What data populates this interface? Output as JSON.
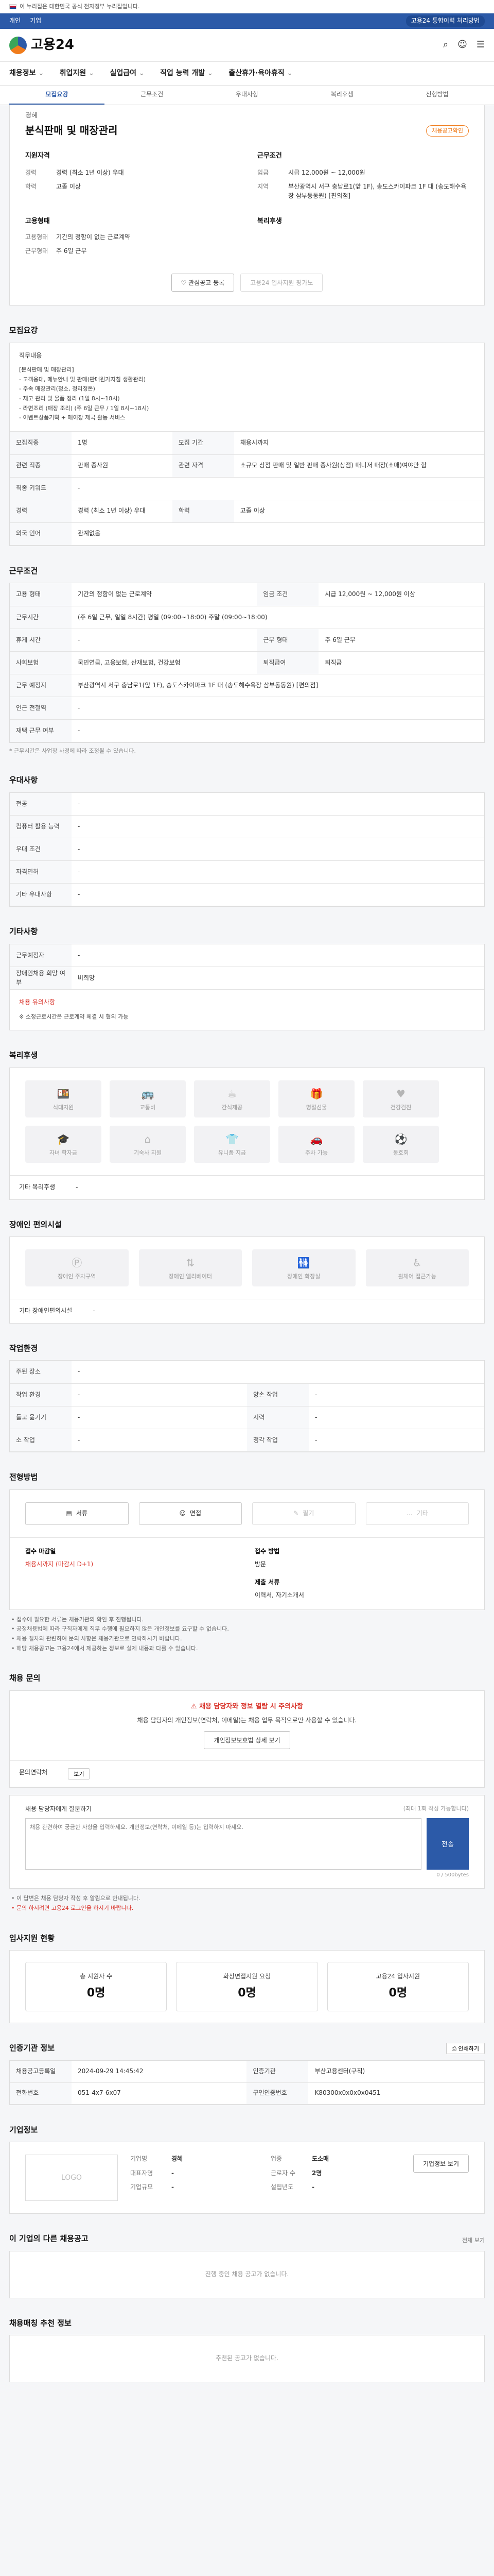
{
  "gov_bar": {
    "text": "이 누리집은 대한민국 공식 전자정부 누리집입니다."
  },
  "util": {
    "left": [
      "개인",
      "기업"
    ],
    "right_pill": "고용24 통합이력 처리방법"
  },
  "logo": {
    "text": "고용24"
  },
  "gnb": [
    "채용정보",
    "취업지원",
    "실업급여",
    "직업 능력 개발",
    "출산휴가·육아휴직"
  ],
  "subtabs": [
    "모집요강",
    "근무조건",
    "우대사항",
    "복리후생",
    "전형방법"
  ],
  "summary": {
    "brand": "경혜",
    "title": "분식판매 및 매장관리",
    "badge": "채용공고확인",
    "qual_title": "지원자격",
    "qual": [
      {
        "k": "경력",
        "v": "경력 (최소 1년 이상) 우대"
      },
      {
        "k": "학력",
        "v": "고졸 이상"
      }
    ],
    "cond_title": "근무조건",
    "cond": [
      {
        "k": "임금",
        "v": "시급 12,000원 ~ 12,000원"
      },
      {
        "k": "지역",
        "v": "부산광역시 서구 충남로1(앞 1F), 송도스카이파크 1F 대 (송도해수욕장 삼부동동원) [편의점]"
      }
    ],
    "form_title": "고용형태",
    "form": [
      {
        "k": "고용형태",
        "v": "기간의 정함이 없는 근로계약"
      },
      {
        "k": "근무형태",
        "v": "주 6일 근무"
      }
    ],
    "benefit_title": "복리후생",
    "btn_scrap": "관심공고 등록",
    "btn_sim": "고용24 입사지원 평가노"
  },
  "recruit": {
    "title": "모집요강",
    "desc_label": "직무내용",
    "desc": "[분식판매 및 매장관리]\n- 고객응대, 메뉴안내 및 판매(판매원가지침 생활관리)\n- 주속 매장관리(청소, 정리정돈)\n- 재고 관리 및 물품 정리 (1일 8시~18시)\n- 라면조리 (매장 조리) (주 6일 근무 / 1일 8시~18시)\n- 이벤트상품기획 + 매이창 제국 활동 서비스",
    "rows": [
      [
        {
          "k": "모집직종",
          "v": "1명"
        },
        {
          "k": "모집 기간",
          "v": "채용시까지"
        }
      ],
      [
        {
          "k": "관련 직종",
          "v": "판매 종사원"
        },
        {
          "k": "관련 자격",
          "v": "소규모 상점 판매 및 일반 판매 종사원(상점) 매니저 매장(소매)여야만 함"
        }
      ],
      [
        {
          "k": "직종 키워드",
          "v": "-"
        },
        {
          "k": "",
          "v": ""
        }
      ],
      [
        {
          "k": "경력",
          "v": "경력 (최소 1년 이상) 우대"
        },
        {
          "k": "학력",
          "v": "고졸 이상"
        }
      ],
      [
        {
          "k": "외국 언어",
          "v": "관계없음"
        },
        {
          "k": "",
          "v": ""
        }
      ]
    ]
  },
  "work": {
    "title": "근무조건",
    "rows": [
      [
        {
          "k": "고용 형태",
          "v": "기간의 정함이 없는 근로계약"
        },
        {
          "k": "임금 조건",
          "v": "시급 12,000원 ~ 12,000원 이상"
        }
      ],
      [
        {
          "k": "근무시간",
          "v": "(주 6일 근무, 일일 8시간) 평일 (09:00~18:00) 주말 (09:00~18:00)"
        },
        {
          "k": "",
          "v": ""
        }
      ],
      [
        {
          "k": "휴게 시간",
          "v": "-"
        },
        {
          "k": "근무 형태",
          "v": "주 6일 근무"
        }
      ],
      [
        {
          "k": "사회보험",
          "v": "국민연금, 고용보험, 산재보험, 건강보험"
        },
        {
          "k": "퇴직급여",
          "v": "퇴직금"
        }
      ],
      [
        {
          "k": "근무 예정지",
          "v": "부산광역시 서구 충남로1(앞 1F), 송도스카이파크 1F 대 (송도해수욕장 삼부동동원) [편의점]"
        },
        {
          "k": "",
          "v": ""
        }
      ],
      [
        {
          "k": "인근 전철역",
          "v": "-"
        },
        {
          "k": "",
          "v": ""
        }
      ],
      [
        {
          "k": "재택 근무 여부",
          "v": "-"
        },
        {
          "k": "",
          "v": ""
        }
      ]
    ],
    "map_btn": "지도 보기",
    "note": "* 근무시간은 사업장 사정에 따라 조정될 수 있습니다."
  },
  "pref": {
    "title": "우대사항",
    "rows": [
      {
        "k": "전공",
        "v": "-"
      },
      {
        "k": "컴퓨터 활용 능력",
        "v": "-"
      },
      {
        "k": "우대 조건",
        "v": "-"
      },
      {
        "k": "자격면허",
        "v": "-"
      },
      {
        "k": "기타 우대사항",
        "v": "-"
      }
    ]
  },
  "etc": {
    "title": "기타사항",
    "rows": [
      {
        "k": "근무예정자",
        "v": "-"
      },
      {
        "k": "장애인채용 희망 여부",
        "v": "비희망"
      }
    ],
    "notice_head": "채용 유의사항",
    "notice": "※ 소정근로시간은 근로계약 체결 시 협의 가능"
  },
  "benefits": {
    "title": "복리후생",
    "items": [
      {
        "icon": "meal-icon",
        "glyph": "🍱",
        "label": "식대지원"
      },
      {
        "icon": "bus-icon",
        "glyph": "🚌",
        "label": "교통비"
      },
      {
        "icon": "coffee-icon",
        "glyph": "☕",
        "label": "간식제공"
      },
      {
        "icon": "gift-icon",
        "glyph": "🎁",
        "label": "명절선물"
      },
      {
        "icon": "health-icon",
        "glyph": "♥",
        "label": "건강검진"
      },
      {
        "icon": "graduation-icon",
        "glyph": "🎓",
        "label": "자녀 학자금"
      },
      {
        "icon": "home-icon",
        "glyph": "⌂",
        "label": "기숙사 지원"
      },
      {
        "icon": "uniform-icon",
        "glyph": "👕",
        "label": "유니폼 지급"
      },
      {
        "icon": "car-icon",
        "glyph": "🚗",
        "label": "주차 가능"
      },
      {
        "icon": "sport-icon",
        "glyph": "⚽",
        "label": "동호회"
      }
    ],
    "info_k": "기타 복리후생",
    "info_v": "-"
  },
  "disability": {
    "title": "장애인 편의시설",
    "items": [
      {
        "icon": "parking-icon",
        "glyph": "Ⓟ",
        "label": "장애인 주차구역"
      },
      {
        "icon": "elevator-icon",
        "glyph": "⇅",
        "label": "장애인 엘리베이터"
      },
      {
        "icon": "restroom-icon",
        "glyph": "🚻",
        "label": "장애인 화장실"
      },
      {
        "icon": "wheelchair-icon",
        "glyph": "♿",
        "label": "휠체어 접근가능"
      }
    ],
    "info_k": "기타 장애인편의시설",
    "info_v": "-"
  },
  "workplace": {
    "title": "작업환경",
    "rows": [
      [
        {
          "k": "주된 장소",
          "v": "-"
        },
        {
          "k": "",
          "v": ""
        }
      ],
      [
        {
          "k": "작업 환경",
          "v": "-"
        },
        {
          "k": "양손 작업",
          "v": "-"
        }
      ],
      [
        {
          "k": "들고 옮기기",
          "v": "-"
        },
        {
          "k": "시력",
          "v": "-"
        }
      ],
      [
        {
          "k": "소 작업",
          "v": "-"
        },
        {
          "k": "청각 작업",
          "v": "-"
        }
      ]
    ]
  },
  "method": {
    "title": "전형방법",
    "items": [
      {
        "icon": "document-icon",
        "glyph": "▤",
        "label": "서류",
        "dim": false
      },
      {
        "icon": "interview-icon",
        "glyph": "☺",
        "label": "면접",
        "dim": false
      },
      {
        "icon": "test-icon",
        "glyph": "✎",
        "label": "필기",
        "dim": true
      },
      {
        "icon": "other-icon",
        "glyph": "…",
        "label": "기타",
        "dim": true
      }
    ],
    "docs_head": "접수 마감일",
    "docs_v": "채용시까지 (마감시 D+1)",
    "way_head": "접수 방법",
    "way_v": "방문",
    "submit_head": "제출 서류",
    "submit_v": "이력서, 자기소개서",
    "bullets": [
      "• 접수에 필요한 서류는 채용기관의 확인 후 진행됩니다.",
      "• 공정채용법에 따라 구직자에게 직무 수행에 필요하지 않은 개인정보를 요구할 수 없습니다.",
      "• 채용 절차와 관련하여 문의 사항은 채용기관으로 연락하시기 바랍니다.",
      "• 해당 채용공고는 고용24에서 제공하는 정보로 실제 내용과 다를 수 있습니다."
    ]
  },
  "inquiry": {
    "title": "채용 문의",
    "caution_head": "채용 담당자와 정보 열람 시 주의사항",
    "caution_text": "채용 담당자의 개인정보(연락처, 이메일)는 채용 업무 목적으로만 사용할 수 있습니다.",
    "caution_btn": "개인정보보호법 상세 보기",
    "contact_k": "문의연락처",
    "contact_btn": "보기",
    "q_label": "채용 담당자에게 질문하기",
    "q_note": "(최대 1회 작성 가능합니다)",
    "q_placeholder": "채용 관련하여 궁금한 사항을 입력하세요. 개인정보(연락처, 이메일 등)는 입력하지 마세요.",
    "send": "전송",
    "counter": "0 / 500bytes",
    "q_bullets": [
      "• 이 답변은 채용 담당자 작성 후 알림으로 안내됩니다.",
      "• 문의 하시려면 고용24 로그인을 하시기 바랍니다."
    ]
  },
  "status": {
    "title": "입사지원 현황",
    "items": [
      {
        "label": "총 지원자 수",
        "num": "0명"
      },
      {
        "label": "화상면접지원 요청",
        "num": "0명"
      },
      {
        "label": "고용24 입사지원",
        "num": "0명"
      }
    ]
  },
  "manager": {
    "title": "인증기관 정보",
    "print": "인쇄하기",
    "rows": [
      [
        {
          "k": "채용공고등록일",
          "v": "2024-09-29 14:45:42"
        },
        {
          "k": "인증기관",
          "v": "부산고용센터(구직)"
        }
      ],
      [
        {
          "k": "전화번호",
          "v": "051-4x7-6x07"
        },
        {
          "k": "구인인증번호",
          "v": "K80300x0x0x0x0451"
        }
      ]
    ]
  },
  "company": {
    "title": "기업정보",
    "logo": "LOGO",
    "btn": "기업정보 보기",
    "fields": [
      {
        "k": "기업명",
        "v": "경혜"
      },
      {
        "k": "업종",
        "v": "도소매"
      },
      {
        "k": "대표자명",
        "v": "-"
      },
      {
        "k": "근로자 수",
        "v": "2명"
      },
      {
        "k": "기업규모",
        "v": "-"
      },
      {
        "k": "설립년도",
        "v": "-"
      }
    ]
  },
  "other_jobs": {
    "title": "이 기업의 다른 채용공고",
    "more": "전체 보기",
    "empty": "진행 중인 채용 공고가 없습니다."
  },
  "similar": {
    "title": "채용매칭 추천 정보",
    "empty": "추천된 공고가 없습니다."
  }
}
